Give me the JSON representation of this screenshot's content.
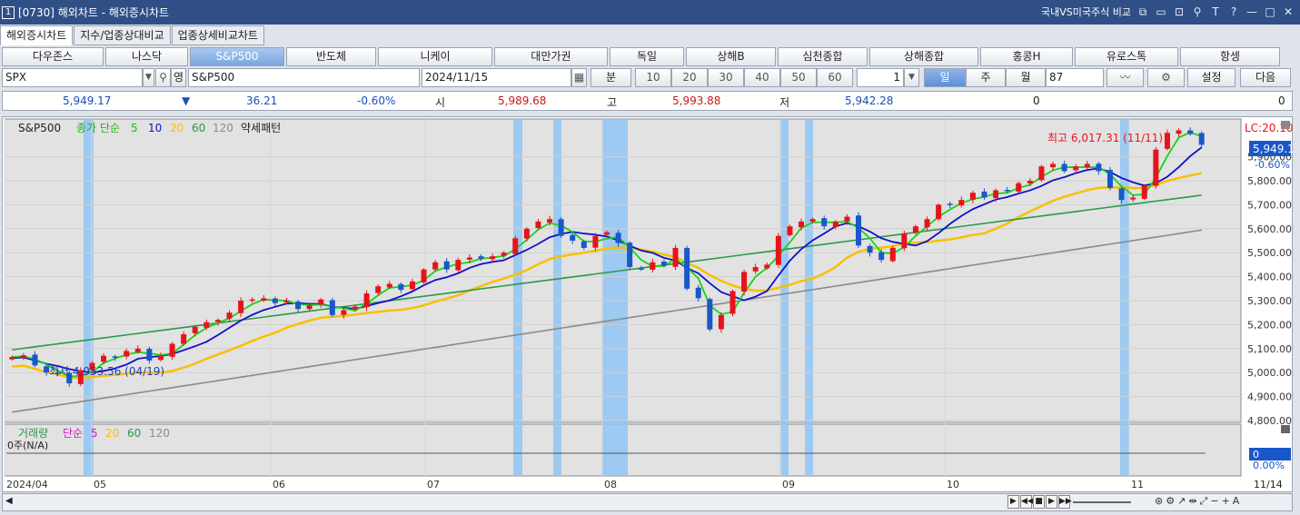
{
  "window": {
    "number": "1",
    "title": "[0730] 해외차트 - 해외증시차트",
    "right_label": "국내VS미국주식 비교"
  },
  "tabs": [
    "해외증시차트",
    "지수/업종상대비교",
    "업종상세비교차트"
  ],
  "markets": [
    "다우존스",
    "나스닥",
    "S&P500",
    "반도체",
    "니케이",
    "대만가권",
    "독일",
    "상해B",
    "심천종합",
    "상해종합",
    "홍콩H",
    "유로스톡",
    "항셍"
  ],
  "controls": {
    "symbol": "SPX",
    "search_toggle": "영",
    "symbol_name": "S&P500",
    "date": "2024/11/15",
    "period_label": "분",
    "periods": [
      "10",
      "20",
      "30",
      "40",
      "50",
      "60"
    ],
    "count": "1",
    "tab_day": "일",
    "tab_week": "주",
    "tab_month": "월",
    "bars": "87",
    "settings": "설정",
    "next": "다음"
  },
  "info": {
    "price": "5,949.17",
    "arrow": "▼",
    "change": "36.21",
    "change_pct": "-0.60%",
    "open_label": "시",
    "open": "5,989.68",
    "high_label": "고",
    "high": "5,993.88",
    "low_label": "저",
    "low": "5,942.28",
    "vol1": "0",
    "vol2": "0"
  },
  "chart": {
    "legend_name": "S&P500",
    "legend_close": "종가 단순",
    "ma_labels": [
      "5",
      "10",
      "20",
      "60",
      "120"
    ],
    "legend_pattern": "약세패턴",
    "lc_label": "LC:20.10",
    "price_tag": "5,949.1",
    "pct_tag": "-0.60%",
    "high_annot": "최고 6,017.31 (11/11)",
    "low_annot": "최저 4,953.56 (04/19)",
    "y_ticks": [
      "5,900.00",
      "5,800.00",
      "5,700.00",
      "5,600.00",
      "5,500.00",
      "5,400.00",
      "5,300.00",
      "5,200.00",
      "5,100.00",
      "5,000.00",
      "4,900.00",
      "4,800.00"
    ],
    "volume_label": "거래량",
    "volume_ma": "단순",
    "volume_ma_labels": [
      "5",
      "20",
      "60",
      "120"
    ],
    "volume_value": "0주(N/A)",
    "vol_tag": "0",
    "vol_pct": "0.00%",
    "x_labels": [
      "2024/04",
      "05",
      "06",
      "07",
      "08",
      "09",
      "10",
      "11"
    ],
    "x_end": "11/14",
    "colors": {
      "up": "#e8131a",
      "down": "#1a57c9",
      "ma5": "#18d418",
      "ma10": "#1010c8",
      "ma20": "#f8c000",
      "ma60": "#2a9a4a",
      "ma120": "#8a8a8a",
      "band": "#8fc6f4"
    }
  },
  "chart_data": {
    "type": "candlestick",
    "title": "S&P500",
    "x_range": [
      "2024/04",
      "2024/11/15"
    ],
    "ylim": [
      4800,
      6050
    ],
    "y_ticks": [
      4800,
      4900,
      5000,
      5100,
      5200,
      5300,
      5400,
      5500,
      5600,
      5700,
      5800,
      5900
    ],
    "last_price": 5949.17,
    "high": {
      "value": 6017.31,
      "date": "11/11"
    },
    "low": {
      "value": 4953.56,
      "date": "04/19"
    },
    "moving_averages": [
      5,
      10,
      20,
      60,
      120
    ],
    "closes": [
      5065,
      5072,
      5030,
      5000,
      4995,
      4955,
      5010,
      5040,
      5070,
      5065,
      5090,
      5100,
      5050,
      5070,
      5120,
      5160,
      5190,
      5210,
      5220,
      5250,
      5300,
      5305,
      5310,
      5290,
      5300,
      5265,
      5280,
      5305,
      5240,
      5260,
      5275,
      5330,
      5360,
      5370,
      5345,
      5380,
      5430,
      5460,
      5430,
      5470,
      5480,
      5475,
      5485,
      5500,
      5560,
      5600,
      5630,
      5640,
      5570,
      5550,
      5520,
      5570,
      5585,
      5540,
      5440,
      5430,
      5460,
      5445,
      5520,
      5350,
      5310,
      5180,
      5240,
      5340,
      5420,
      5440,
      5450,
      5570,
      5610,
      5630,
      5640,
      5610,
      5630,
      5650,
      5530,
      5500,
      5470,
      5520,
      5580,
      5610,
      5640,
      5700,
      5700,
      5720,
      5750,
      5730,
      5760,
      5760,
      5790,
      5800,
      5860,
      5870,
      5840,
      5860,
      5870,
      5840,
      5770,
      5720,
      5730,
      5780,
      5930,
      6000,
      6010,
      5995,
      5950
    ]
  }
}
